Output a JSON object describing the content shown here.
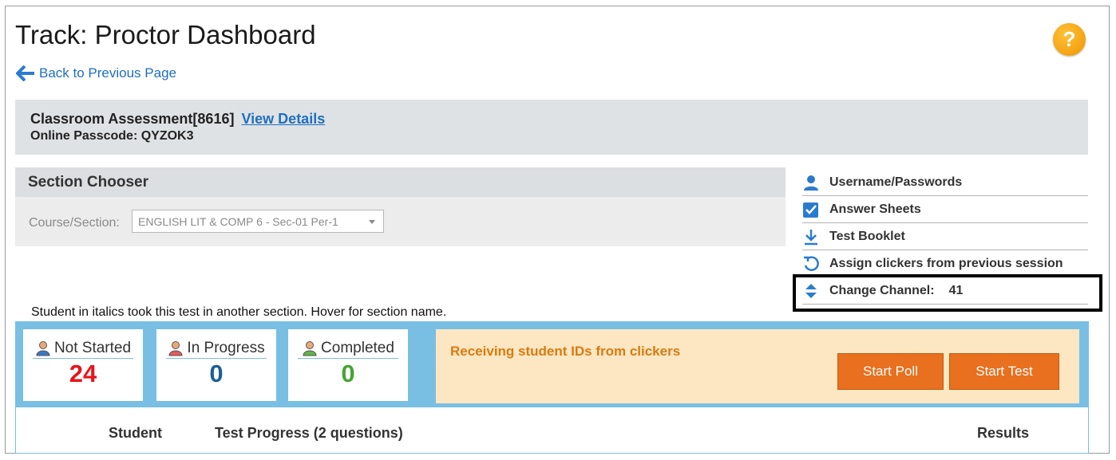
{
  "page": {
    "title": "Track: Proctor Dashboard",
    "back_label": "Back to Previous Page",
    "help_label": "?"
  },
  "assessment": {
    "name": "Classroom Assessment[8616]",
    "view_details": "View Details",
    "passcode": "Online Passcode: QYZOK3"
  },
  "section_chooser": {
    "title": "Section Chooser",
    "label": "Course/Section:",
    "selected": "ENGLISH LIT & COMP 6 - Sec-01 Per-1"
  },
  "side_links": [
    {
      "label": "Username/Passwords",
      "icon": "user-icon"
    },
    {
      "label": "Answer Sheets",
      "icon": "checkbox-icon"
    },
    {
      "label": "Test Booklet",
      "icon": "download-icon"
    },
    {
      "label": "Assign clickers from previous session",
      "icon": "refresh-icon"
    },
    {
      "label": "Change Channel:",
      "icon": "up-down-arrows-icon",
      "value": "41"
    }
  ],
  "note": "Student in italics took this test in another section. Hover for section name.",
  "stats": [
    {
      "label": "Not Started",
      "value": "24",
      "color": "#e8141b",
      "icon": "person-blue-icon"
    },
    {
      "label": "In Progress",
      "value": "0",
      "color": "#1d5f96",
      "icon": "person-red-icon"
    },
    {
      "label": "Completed",
      "value": "0",
      "color": "#43a531",
      "icon": "person-green-icon"
    }
  ],
  "status": {
    "message": "Receiving student IDs from clickers",
    "start_poll": "Start Poll",
    "start_test": "Start Test"
  },
  "table": {
    "col_student": "Student",
    "col_progress": "Test Progress (2 questions)",
    "col_results": "Results"
  },
  "colors": {
    "accent": "#1f6fc0",
    "panel": "#78bfe3",
    "button": "#e8701f",
    "status_bg": "#fde7c2"
  }
}
